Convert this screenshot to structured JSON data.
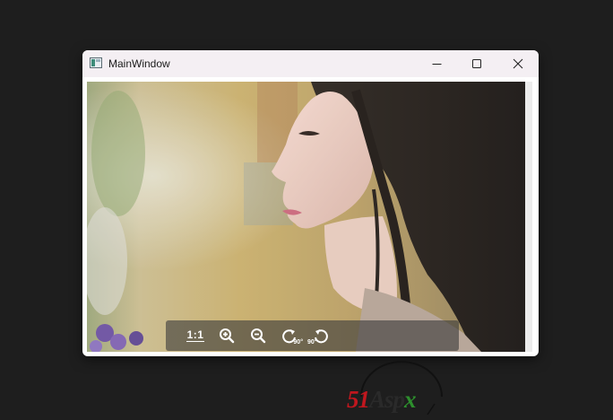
{
  "window": {
    "title": "MainWindow",
    "icons": {
      "app": "window-app-icon",
      "minimize": "minimize-icon",
      "maximize": "maximize-icon",
      "close": "close-icon"
    }
  },
  "viewer": {
    "image_description_icon": "photo-image",
    "toolbar": {
      "actual_size_label": "1:1",
      "zoom_in_icon": "zoom-in-icon",
      "zoom_out_icon": "zoom-out-icon",
      "rotate_right_label": "90°",
      "rotate_left_label": "90°"
    }
  },
  "watermark": {
    "logo_part1": "51",
    "logo_part2": "Asp",
    "logo_part3": "x"
  },
  "colors": {
    "desktop": "#1e1e1e",
    "titlebar": "#f4eff3",
    "toolbar": "#3c3c3c",
    "logo_red": "#c0171e",
    "logo_green": "#2d8f2d"
  }
}
